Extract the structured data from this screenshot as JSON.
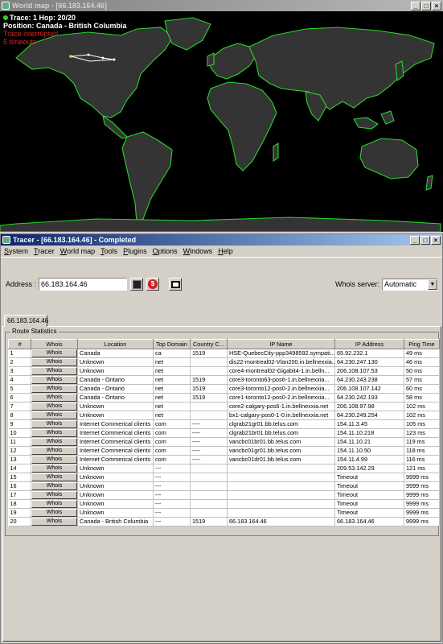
{
  "map_window": {
    "title": "World map - [66.183.164.46]",
    "info": {
      "trace": "Trace: 1  Hop: 20/20",
      "position": "Position: Canada - British Columbia",
      "status": "Trace interrupted",
      "note": "5 timeouts"
    }
  },
  "tracer_window": {
    "title": "Tracer - [66.183.164.46] - Completed",
    "menu": [
      "System",
      "Tracer",
      "World map",
      "Tools",
      "Plugins",
      "Options",
      "Windows",
      "Help"
    ],
    "address_label": "Address :",
    "address_value": "66.183.164.46",
    "whois_label": "Whois server:",
    "whois_value": "Automatic",
    "tab_label": "66.183.164.46",
    "group_label": "Route Statistics",
    "columns": [
      "#",
      "Whois",
      "Location",
      "Top Domain",
      "Country C...",
      "IP Name",
      "IP Address",
      "Ping Time"
    ],
    "whois_button": "Whois",
    "rows": [
      [
        "1",
        "Canada",
        "ca",
        "1519",
        "HSE-QuebecCity-ppp3498592.sympati...",
        "65.92.232.1",
        "49 ms"
      ],
      [
        "2",
        "Unknown",
        "net",
        "",
        "dis22-montreal02-Vlan200.in.bellnexxia...",
        "64.230.247.130",
        "46 ms"
      ],
      [
        "3",
        "Unknown",
        "net",
        "",
        "core4-montreal02-Gigabit4-1.in.belln...",
        "206.108.107.53",
        "50 ms"
      ],
      [
        "4",
        "Canada - Ontario",
        "net",
        "1519",
        "core3-toronto63-pos6-1.in.bellnexxia...",
        "64.230.243.238",
        "57 ms"
      ],
      [
        "5",
        "Canada - Ontario",
        "net",
        "1519",
        "core3-toronto12-pos0-2.in.bellnexxia...",
        "206.108.107.142",
        "60 ms"
      ],
      [
        "6",
        "Canada - Ontario",
        "net",
        "1519",
        "core1-toronto12-pos0-2.in.bellnexxia...",
        "64.230.242.193",
        "58 ms"
      ],
      [
        "7",
        "Unknown",
        "net",
        "",
        "core2-calgary-pos6-1.in.bellnexxia.net",
        "206.108.97.98",
        "102 ms"
      ],
      [
        "8",
        "Unknown",
        "net",
        "",
        "bx1-calgary-pos0-1-0.in.bellnexxia.net",
        "64.230.249.254",
        "102 ms"
      ],
      [
        "9",
        "Internet Commerical clients",
        "com",
        "----",
        "clgrab21gr01.bb.telus.com",
        "154.11.3.45",
        "105 ms"
      ],
      [
        "10",
        "Internet Commerical clients",
        "com",
        "----",
        "clgrab21br01.bb.telus.com",
        "154.11.10.218",
        "123 ms"
      ],
      [
        "11",
        "Internet Commerical clients",
        "com",
        "----",
        "vancbc01br01.bb.telus.com",
        "154.11.10.21",
        "119 ms"
      ],
      [
        "12",
        "Internet Commerical clients",
        "com",
        "----",
        "vancbc01gr01.bb.telus.com",
        "154.11.10.50",
        "118 ms"
      ],
      [
        "13",
        "Internet Commerical clients",
        "com",
        "----",
        "vancbc01dr01.bb.telus.com",
        "154.11.4.99",
        "116 ms"
      ],
      [
        "14",
        "Unknown",
        "---",
        "",
        "",
        "209.53.142.29",
        "121 ms"
      ],
      [
        "15",
        "Unknown",
        "---",
        "",
        "",
        "Timeout",
        "9999 ms"
      ],
      [
        "16",
        "Unknown",
        "---",
        "",
        "",
        "Timeout",
        "9999 ms"
      ],
      [
        "17",
        "Unknown",
        "---",
        "",
        "",
        "Timeout",
        "9999 ms"
      ],
      [
        "18",
        "Unknown",
        "---",
        "",
        "",
        "Timeout",
        "9999 ms"
      ],
      [
        "19",
        "Unknown",
        "---",
        "",
        "",
        "Timeout",
        "9999 ms"
      ],
      [
        "20",
        "Canada - British Columbia",
        "---",
        "1519",
        "66.183.164.46",
        "66.183.164.46",
        "9999 ms"
      ]
    ]
  },
  "colors": {
    "map_bg": "#000000",
    "coast": "#2bd42b",
    "land": "#3a3a3a",
    "route": "#ffffff"
  }
}
